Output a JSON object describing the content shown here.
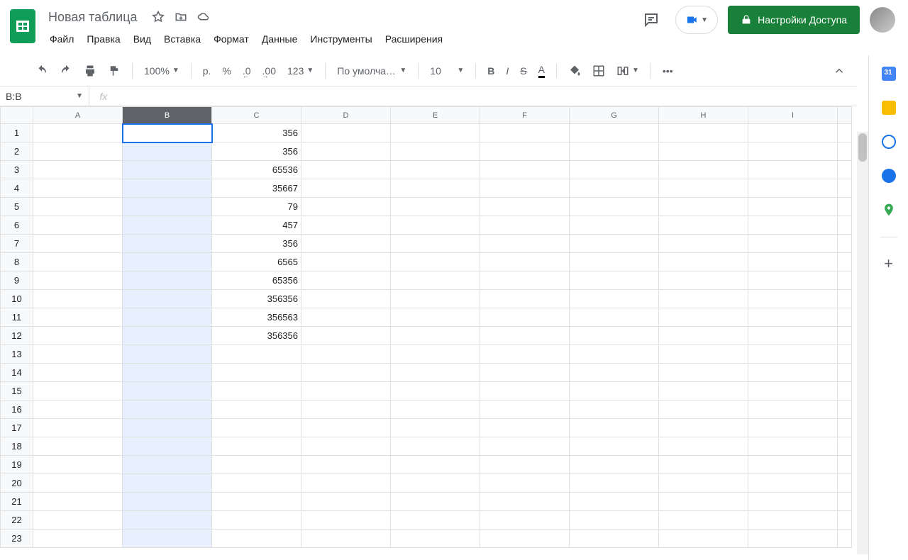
{
  "header": {
    "doc_title": "Новая таблица",
    "menu": [
      "Файл",
      "Правка",
      "Вид",
      "Вставка",
      "Формат",
      "Данные",
      "Инструменты",
      "Расширения"
    ],
    "share_label": "Настройки Доступа"
  },
  "toolbar": {
    "zoom": "100%",
    "currency": "р.",
    "percent": "%",
    "dec_dec": ".0",
    "inc_dec": ".00",
    "num_fmt": "123",
    "font": "По умолча…",
    "font_size": "10"
  },
  "namebox": {
    "value": "B:B",
    "fx": "fx"
  },
  "grid": {
    "columns": [
      "A",
      "B",
      "C",
      "D",
      "E",
      "F",
      "G",
      "H",
      "I"
    ],
    "selected_col_index": 1,
    "active_row": 1,
    "rows": 23,
    "data_c": [
      "356",
      "356",
      "65536",
      "35667",
      "79",
      "457",
      "356",
      "6565",
      "65356",
      "356356",
      "356563",
      "356356"
    ]
  },
  "side": {
    "calendar_color": "#4285f4",
    "keep_color": "#fbbc04",
    "tasks_color": "#1a73e8",
    "contacts_color": "#1a73e8",
    "maps_color": "#34a853"
  }
}
